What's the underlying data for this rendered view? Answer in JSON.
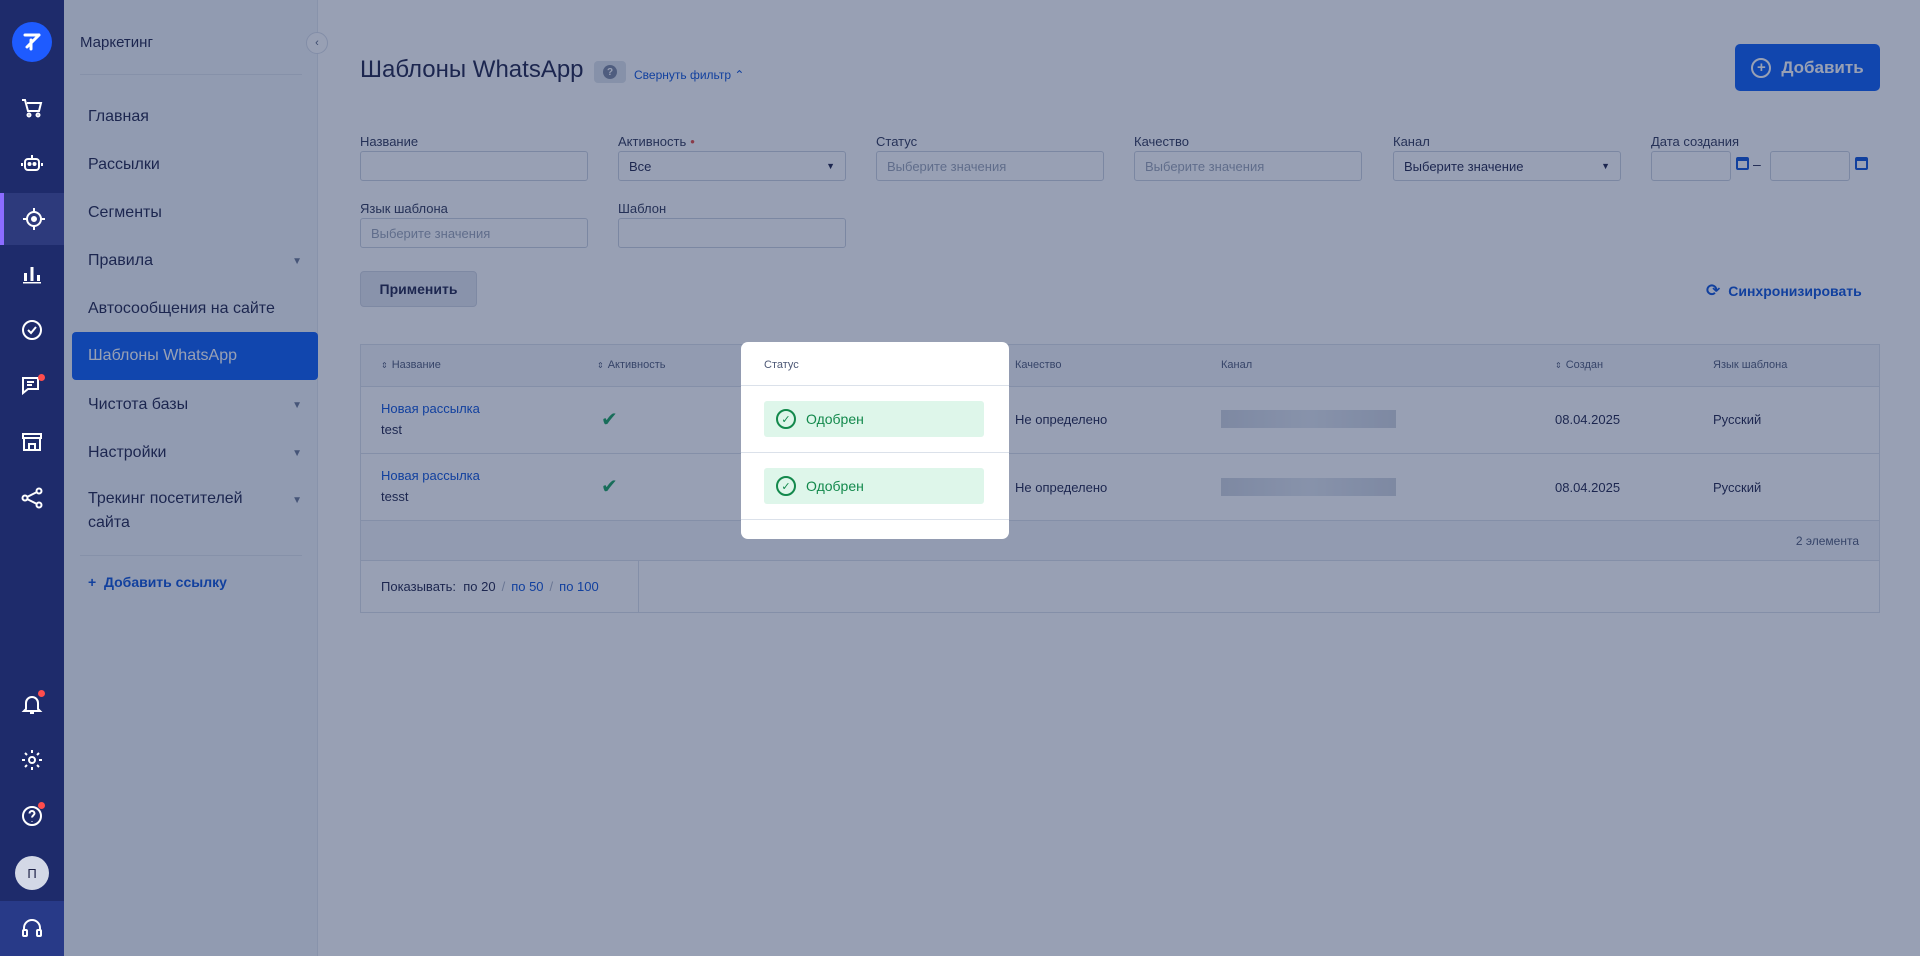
{
  "sidebar": {
    "section_title": "Маркетинг",
    "items": [
      {
        "label": "Главная"
      },
      {
        "label": "Рассылки"
      },
      {
        "label": "Сегменты"
      },
      {
        "label": "Правила",
        "expandable": true
      },
      {
        "label": "Автосообщения на сайте"
      },
      {
        "label": "Шаблоны WhatsApp",
        "active": true
      },
      {
        "label": "Чистота базы",
        "expandable": true
      },
      {
        "label": "Настройки",
        "expandable": true
      },
      {
        "label": "Трекинг посетителей сайта",
        "expandable": true
      }
    ],
    "add_link": "Добавить ссылку"
  },
  "rail": {
    "icons": [
      "logo-icon",
      "cart-icon",
      "bot-icon",
      "target-icon",
      "analytics-icon",
      "tasks-icon",
      "chat-icon",
      "store-icon",
      "integrations-icon",
      "notifications-icon",
      "settings-icon",
      "help-icon",
      "avatar",
      "support-icon"
    ],
    "avatar_initial": "П"
  },
  "header": {
    "title": "Шаблоны WhatsApp",
    "collapse_filter": "Свернуть фильтр",
    "add_button": "Добавить"
  },
  "filters": {
    "name": {
      "label": "Название",
      "value": ""
    },
    "activity": {
      "label": "Активность",
      "value": "Все"
    },
    "status": {
      "label": "Статус",
      "placeholder": "Выберите значения"
    },
    "quality": {
      "label": "Качество",
      "placeholder": "Выберите значения"
    },
    "channel": {
      "label": "Канал",
      "placeholder": "Выберите значение"
    },
    "created": {
      "label": "Дата создания",
      "separator": "–"
    },
    "language": {
      "label": "Язык шаблона",
      "placeholder": "Выберите значения"
    },
    "template": {
      "label": "Шаблон",
      "value": ""
    },
    "apply_button": "Применить",
    "sync_button": "Синхронизировать"
  },
  "table": {
    "columns": {
      "name": "Название",
      "activity": "Активность",
      "status": "Статус",
      "quality": "Качество",
      "channel": "Канал",
      "created": "Создан",
      "language": "Язык шаблона"
    },
    "rows": [
      {
        "name": "Новая рассылка",
        "sub": "test",
        "active": true,
        "status": "Одобрен",
        "quality": "Не определено",
        "created": "08.04.2025",
        "language": "Русский"
      },
      {
        "name": "Новая рассылка",
        "sub": "tesst",
        "active": true,
        "status": "Одобрен",
        "quality": "Не определено",
        "created": "08.04.2025",
        "language": "Русский"
      }
    ],
    "count_label": "2 элемента",
    "pager": {
      "label": "Показывать:",
      "current": "по 20",
      "options": [
        "по 50",
        "по 100"
      ]
    }
  },
  "colors": {
    "primary": "#0a5cf5",
    "rail": "#1e2b6b",
    "success": "#13894c",
    "success_bg": "#def6ea"
  }
}
